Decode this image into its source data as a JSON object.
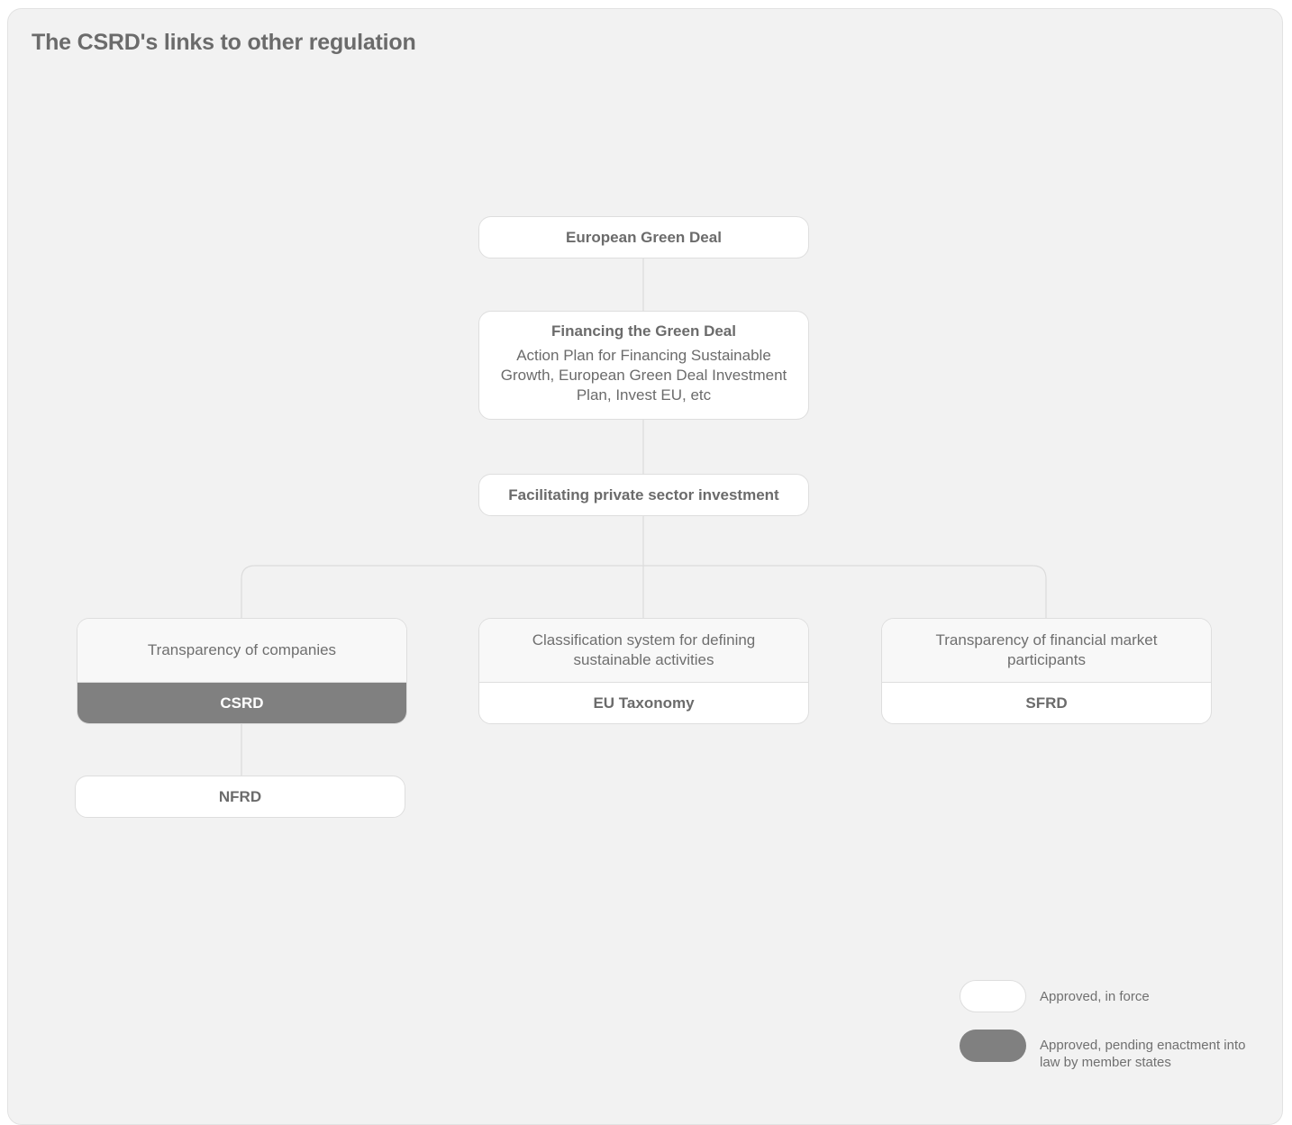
{
  "title": "The CSRD's links to other regulation",
  "colors": {
    "panel_background": "#f2f2f2",
    "node_background": "#ffffff",
    "pending_background": "#808080",
    "text": "#6b6b6b",
    "connector": "#dcdcdc"
  },
  "nodes": {
    "green_deal": {
      "label": "European Green Deal"
    },
    "financing": {
      "label": "Financing the Green Deal",
      "detail": "Action Plan for Financing Sustainable Growth, European Green Deal Investment Plan, Invest EU, etc"
    },
    "facilitating": {
      "label": "Facilitating private sector investment"
    },
    "companies": {
      "description": "Transparency of companies",
      "label": "CSRD",
      "status": "pending"
    },
    "taxonomy": {
      "description": "Classification system for defining sustainable activities",
      "label": "EU Taxonomy",
      "status": "approved"
    },
    "financial": {
      "description": "Transparency of financial market participants",
      "label": "SFRD",
      "status": "approved"
    },
    "nfrd": {
      "label": "NFRD",
      "status": "approved"
    }
  },
  "legend": [
    {
      "key": "approved",
      "label": "Approved, in force"
    },
    {
      "key": "pending",
      "label": "Approved, pending enactment into law by member states"
    }
  ]
}
